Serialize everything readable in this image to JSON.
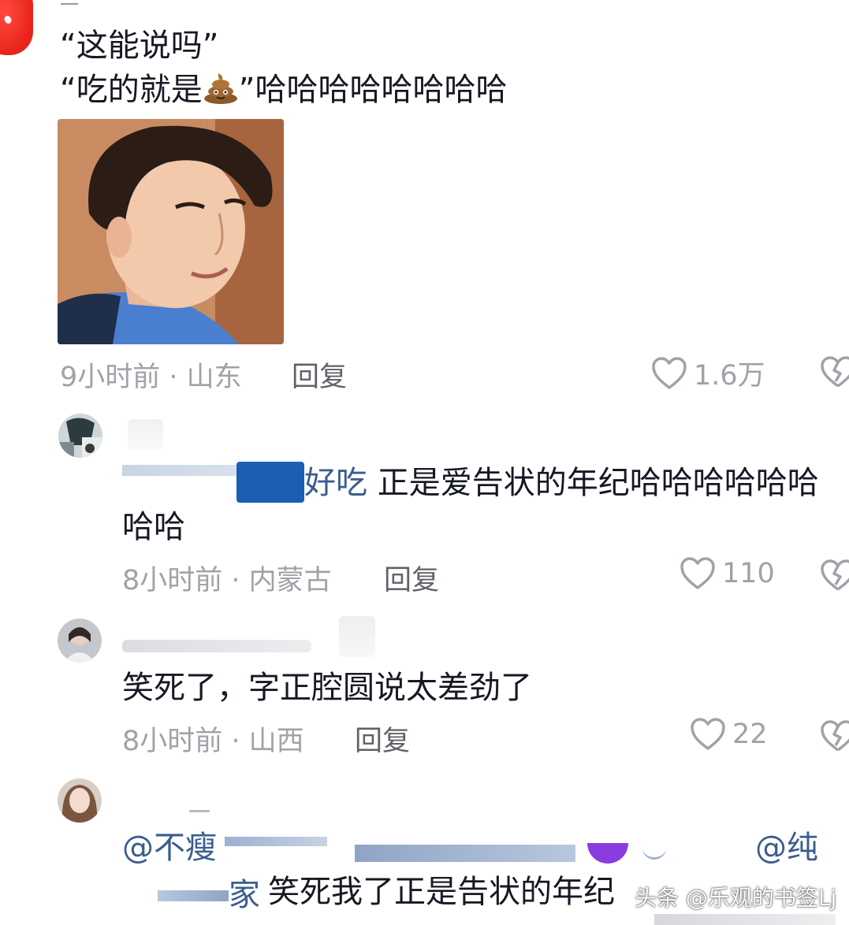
{
  "comments": [
    {
      "name_fragment": "一",
      "lines": [
        "“这能说吗”",
        "“吃的就是",
        "”哈哈哈哈哈哈哈哈"
      ],
      "emoji": "poop-emoji",
      "time": "9小时前 · 山东",
      "reply": "回复",
      "likes": "1.6万"
    },
    {
      "mention": "好吃",
      "text": "正是爱告状的年纪哈哈哈哈哈哈",
      "text_cont": "哈哈",
      "time": "8小时前 · 内蒙古",
      "reply": "回复",
      "likes": "110"
    },
    {
      "text": "笑死了，字正腔圆说太差劲了",
      "time": "8小时前 · 山西",
      "reply": "回复",
      "likes": "22"
    },
    {
      "mention_start": "@不瘦",
      "mention_end": "@纯",
      "line2_prefix": "家",
      "line2_text": "笑死我了正是告状的年纪"
    }
  ],
  "watermark": "头条 @乐观的书签Lj",
  "colors": {
    "text": "#161823",
    "meta": "#a1a2a8",
    "reply": "#606269",
    "mention": "#3b5d8f",
    "redaction": "#1a5fb4"
  },
  "icons": [
    "heart-outline-icon",
    "broken-heart-icon"
  ]
}
